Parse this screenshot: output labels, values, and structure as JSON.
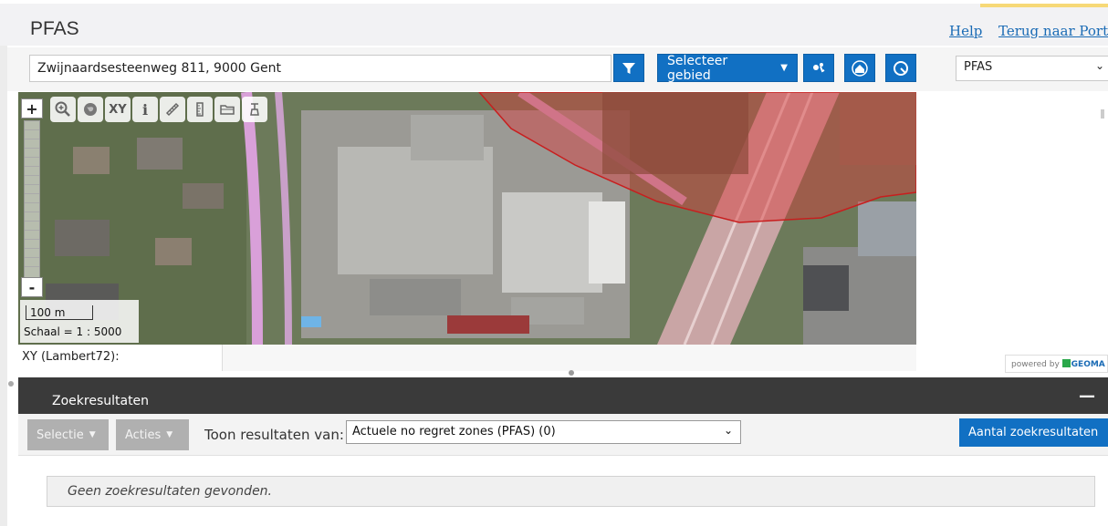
{
  "header": {
    "title": "PFAS",
    "links": {
      "help": "Help",
      "portal": "Terug naar Portaal"
    }
  },
  "toolbar": {
    "search_value": "Zwijnaardsesteenweg 811, 9000 Gent",
    "filter_icon": "filter-icon",
    "select_area_label": "Selecteer gebied",
    "tool_icons": [
      "locate-person-icon",
      "home-icon",
      "zoom-reset-icon"
    ],
    "layer_select": "PFAS"
  },
  "map": {
    "tools": [
      "zoom-box-icon",
      "globe-icon",
      "XY",
      "i",
      "ruler-icon",
      "measure-icon",
      "folder-icon",
      "clear-icon"
    ],
    "zoom_in": "+",
    "zoom_out": "-",
    "scale_bar_label": "100 m",
    "scale_text": "Schaal = 1 : 5000",
    "coordinate_label": "XY (Lambert72):",
    "powered_by": "powered by",
    "powered_brand": "GEOMA"
  },
  "results": {
    "title": "Zoekresultaten",
    "selectie_label": "Selectie",
    "acties_label": "Acties",
    "show_label": "Toon resultaten van:",
    "select_value": "Actuele no regret zones (PFAS) (0)",
    "count_button": "Aantal zoekresultaten",
    "empty_message": "Geen zoekresultaten gevonden."
  },
  "colors": {
    "accent_blue": "#1170c3",
    "header_bar": "#3a3a3a",
    "zone_red": "#d93a3a"
  }
}
